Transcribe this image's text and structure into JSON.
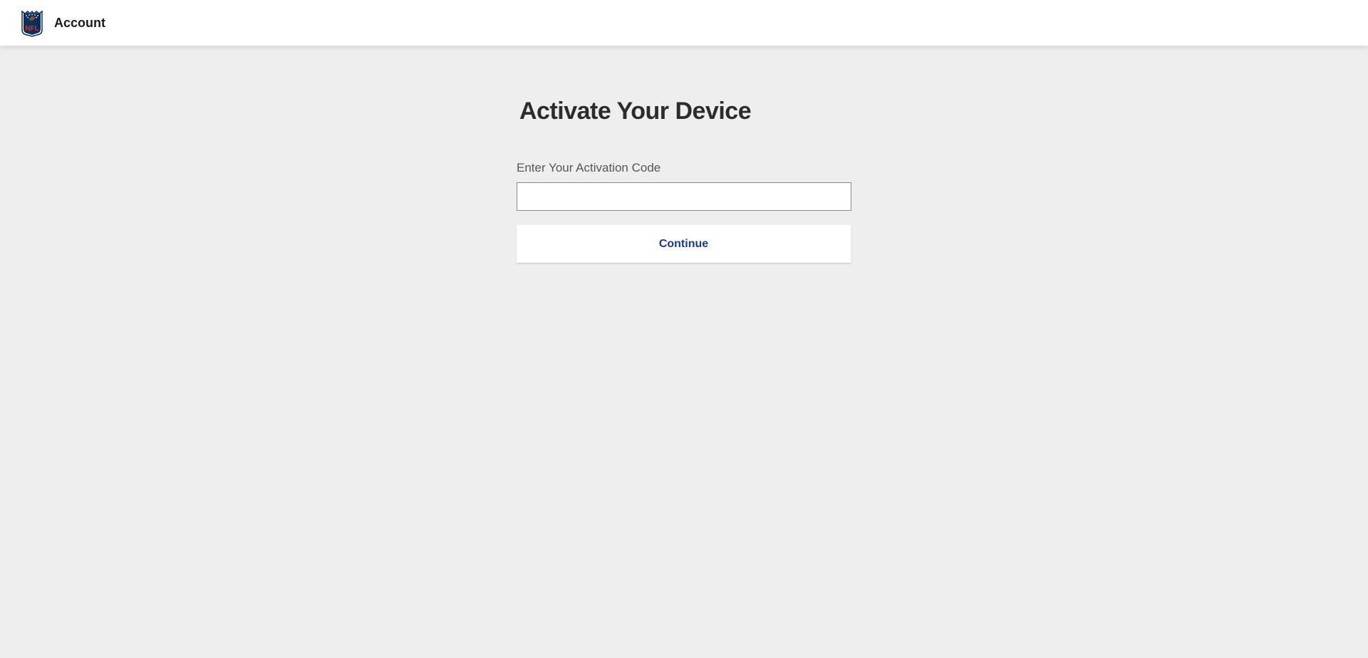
{
  "header": {
    "title": "Account"
  },
  "main": {
    "heading": "Activate Your Device",
    "activation_label": "Enter Your Activation Code",
    "activation_value": "",
    "continue_label": "Continue"
  }
}
